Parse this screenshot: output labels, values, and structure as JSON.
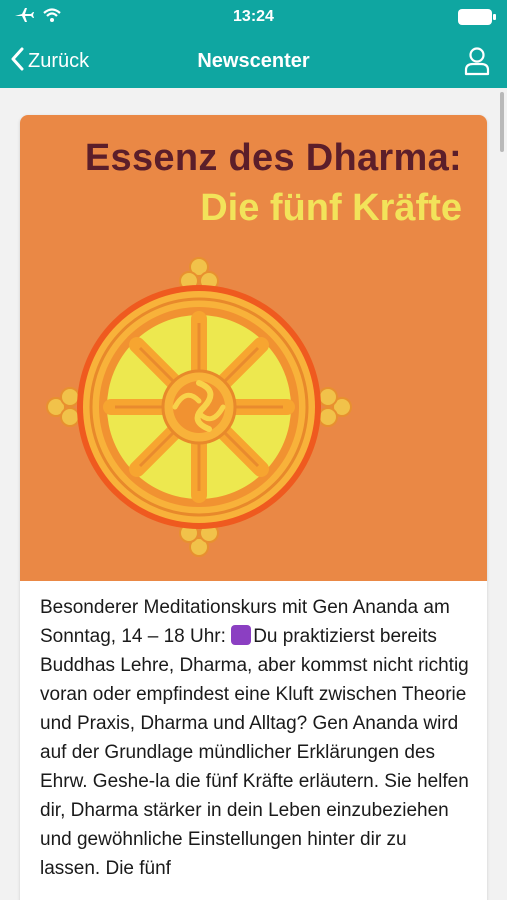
{
  "status_bar": {
    "time": "13:24"
  },
  "nav": {
    "back_label": "Zurück",
    "title": "Newscenter"
  },
  "article": {
    "image_title_line1": "Essenz des Dharma:",
    "image_title_line2": "Die fünf Kräfte",
    "text_before_emoji": "Besonderer Meditationskurs mit Gen Ananda am Sonntag, 14 – 18 Uhr: ",
    "emoji": "☸️",
    "text_after_emoji": "Du praktizierst bereits Buddhas Lehre, Dharma, aber kommst nicht richtig voran oder empfindest eine Kluft zwischen Theorie und Praxis, Dharma und Alltag? Gen Ananda wird auf der Grundlage mündlicher Erklärungen des Ehrw. Geshe-la die fünf Kräfte erläutern. Sie helfen dir, Dharma stärker in dein Leben einzubeziehen und gewöhnliche Einstellungen hinter dir zu lassen. Die fünf"
  },
  "colors": {
    "accent": "#0fa6a1",
    "hero_bg": "#ea8845",
    "title_dark": "#5b1e2a",
    "title_yellow": "#f2e35a"
  }
}
